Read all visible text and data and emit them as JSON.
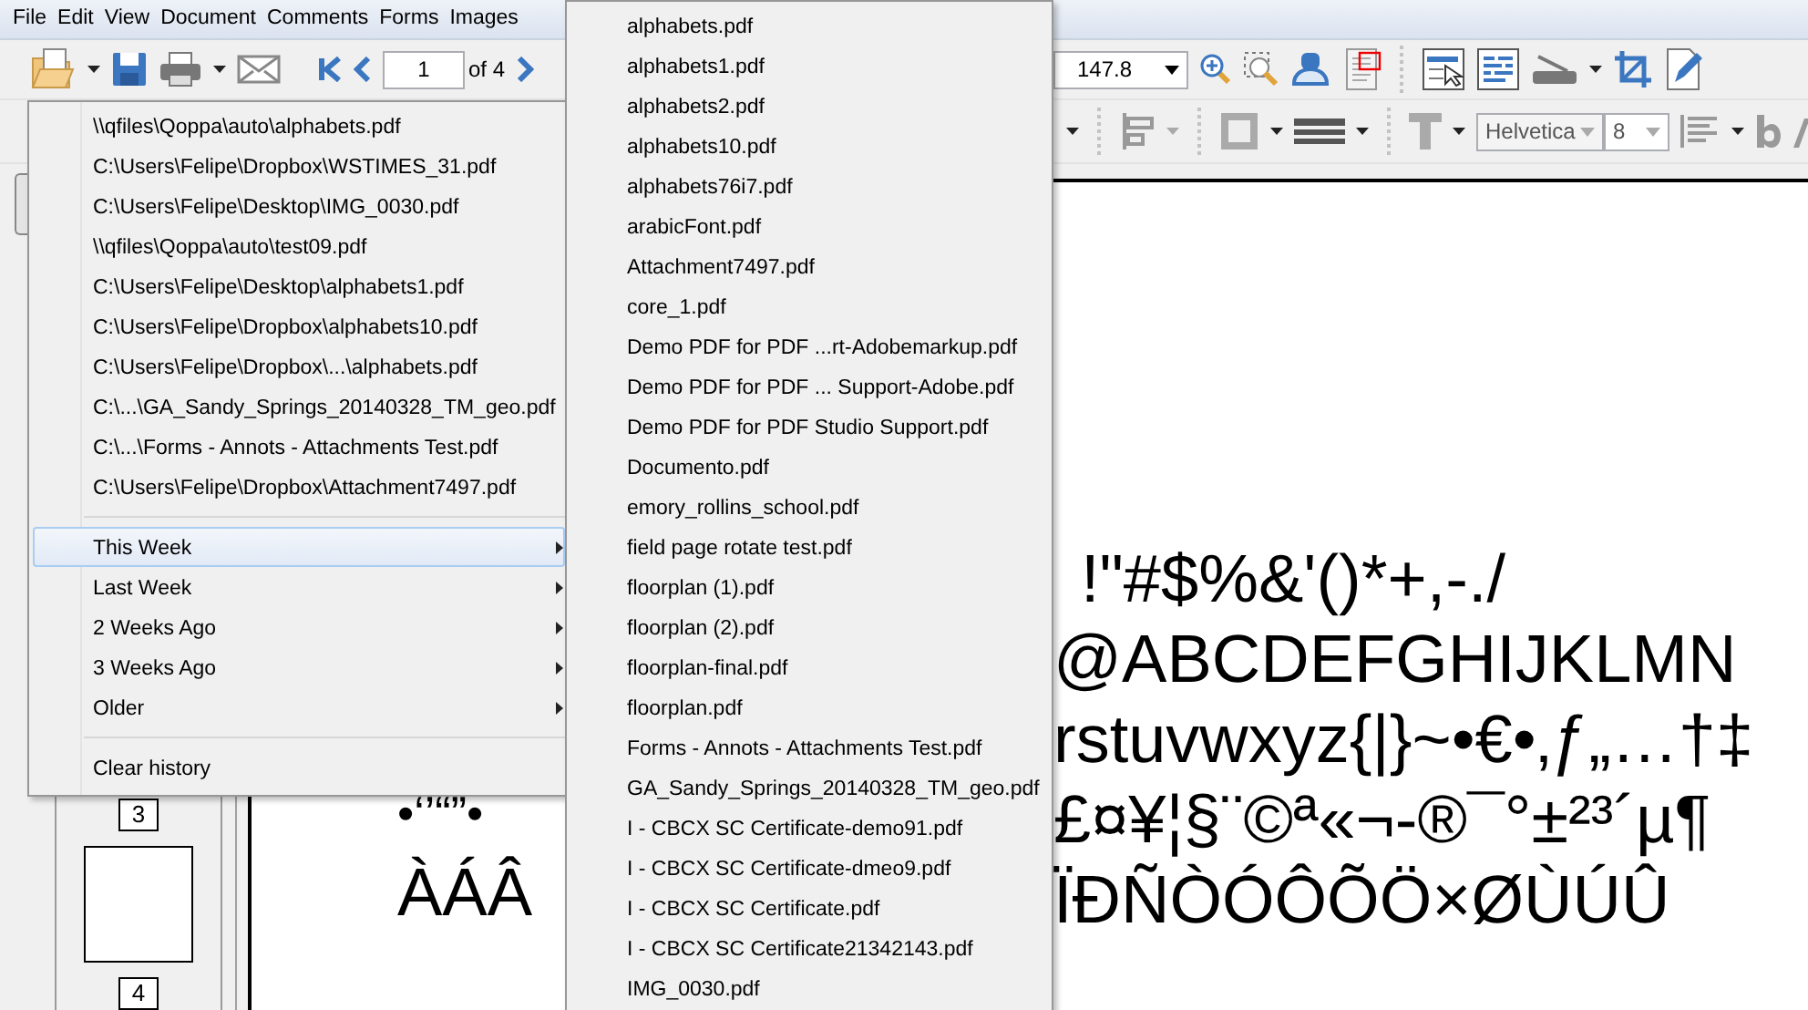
{
  "menu_bar": {
    "items": [
      {
        "label": "File"
      },
      {
        "label": "Edit"
      },
      {
        "label": "View"
      },
      {
        "label": "Document"
      },
      {
        "label": "Comments"
      },
      {
        "label": "Forms"
      },
      {
        "label": "Images"
      }
    ]
  },
  "toolbar": {
    "page_field": {
      "value": "1"
    },
    "page_count": "of 4",
    "zoom_field": {
      "value": "147.8"
    },
    "font_field": {
      "value": "Helvetica"
    },
    "size_field": {
      "value": "8"
    }
  },
  "thumbnails": [
    {
      "label": "3"
    },
    {
      "label": "4"
    }
  ],
  "document": {
    "left_fragments": [
      "•‘’“”•",
      "ÀÁÂ"
    ],
    "right_fragments": [
      "!\"#$%&'()*+,-./",
      "@ABCDEFGHIJKLMN",
      "rstuvwxyz{|}~•€•‚ƒ„…†‡",
      "£¤¥¦§¨©ª«¬-®¯°±²³´µ¶",
      "ÏÐÑÒÓÔÕÖ×ØÙÚÛ"
    ]
  },
  "recent_menu": {
    "files": [
      "\\\\qfiles\\Qoppa\\auto\\alphabets.pdf",
      "C:\\Users\\Felipe\\Dropbox\\WSTIMES_31.pdf",
      "C:\\Users\\Felipe\\Desktop\\IMG_0030.pdf",
      "\\\\qfiles\\Qoppa\\auto\\test09.pdf",
      "C:\\Users\\Felipe\\Desktop\\alphabets1.pdf",
      "C:\\Users\\Felipe\\Dropbox\\alphabets10.pdf",
      "C:\\Users\\Felipe\\Dropbox\\...\\alphabets.pdf",
      "C:\\...\\GA_Sandy_Springs_20140328_TM_geo.pdf",
      "C:\\...\\Forms - Annots - Attachments Test.pdf",
      "C:\\Users\\Felipe\\Dropbox\\Attachment7497.pdf"
    ],
    "groups": [
      {
        "label": "This Week",
        "selected": true
      },
      {
        "label": "Last Week",
        "selected": false
      },
      {
        "label": "2 Weeks Ago",
        "selected": false
      },
      {
        "label": "3 Weeks Ago",
        "selected": false
      },
      {
        "label": "Older",
        "selected": false
      }
    ],
    "clear": "Clear history"
  },
  "submenu": {
    "files": [
      "alphabets.pdf",
      "alphabets1.pdf",
      "alphabets2.pdf",
      "alphabets10.pdf",
      "alphabets76i7.pdf",
      "arabicFont.pdf",
      "Attachment7497.pdf",
      "core_1.pdf",
      "Demo PDF for PDF ...rt-Adobemarkup.pdf",
      "Demo PDF for PDF ... Support-Adobe.pdf",
      "Demo PDF for PDF Studio Support.pdf",
      "Documento.pdf",
      "emory_rollins_school.pdf",
      "field page rotate test.pdf",
      "floorplan (1).pdf",
      "floorplan (2).pdf",
      "floorplan-final.pdf",
      "floorplan.pdf",
      "Forms - Annots - Attachments Test.pdf",
      "GA_Sandy_Springs_20140328_TM_geo.pdf",
      "I - CBCX SC Certificate-demo91.pdf",
      "I - CBCX SC Certificate-dmeo9.pdf",
      "I - CBCX SC Certificate.pdf",
      "I - CBCX SC Certificate21342143.pdf",
      "IMG_0030.pdf"
    ]
  }
}
